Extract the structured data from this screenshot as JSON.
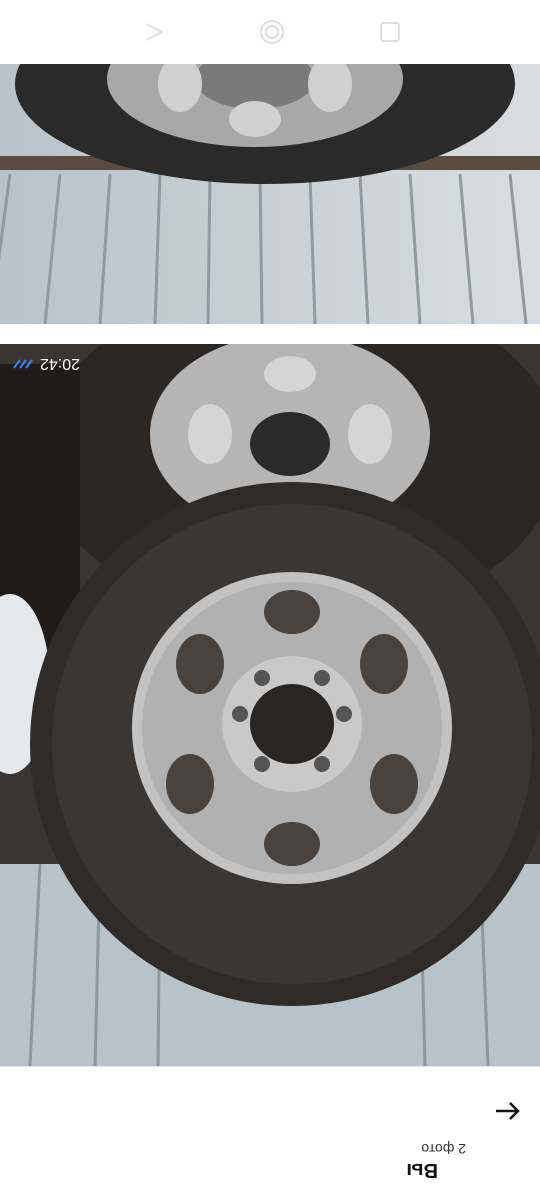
{
  "status_bar": {
    "time": "20:42",
    "icons": [
      "signal-icon"
    ]
  },
  "navigation": {
    "back_icon": "back-icon",
    "home_icon": "home-icon",
    "recent_icon": "recent-apps-icon"
  },
  "photos": {
    "top_photo": "tire-photo-1",
    "main_photo": "tire-photo-2"
  },
  "message": {
    "sender": "Вы",
    "attachment_count": "2 фото",
    "forward_icon": "arrow-icon"
  },
  "colors": {
    "background": "#ffffff",
    "accent": "#3b82f6"
  }
}
